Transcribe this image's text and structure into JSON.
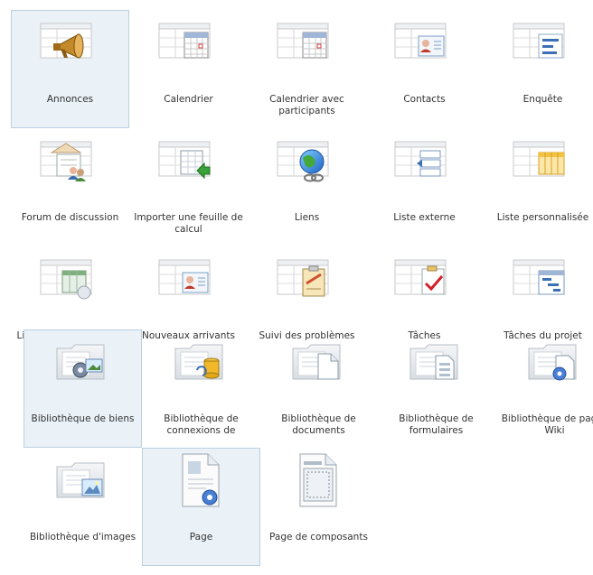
{
  "items": [
    {
      "label": "Annonces",
      "icon": "megaphone-icon"
    },
    {
      "label": "Calendrier",
      "icon": "calendar-icon"
    },
    {
      "label": "Calendrier avec participants",
      "icon": "calendar-icon"
    },
    {
      "label": "Contacts",
      "icon": "contact-card-icon"
    },
    {
      "label": "Enquête",
      "icon": "survey-icon"
    },
    {
      "label": "Forum de discussion",
      "icon": "discussion-icon"
    },
    {
      "label": "Importer une feuille de calcul",
      "icon": "import-spreadsheet-icon"
    },
    {
      "label": "Liens",
      "icon": "globe-link-icon"
    },
    {
      "label": "Liste externe",
      "icon": "external-list-icon"
    },
    {
      "label": "Liste personnalisée",
      "icon": "custom-list-icon"
    },
    {
      "label": "Liste personnalisée en mode Feuille de",
      "icon": "datasheet-icon"
    },
    {
      "label": "Nouveaux arrivants",
      "icon": "contact-card-icon"
    },
    {
      "label": "Suivi des problèmes",
      "icon": "clipboard-icon"
    },
    {
      "label": "Tâches",
      "icon": "task-check-icon"
    },
    {
      "label": "Tâches du projet",
      "icon": "gantt-icon"
    },
    {
      "label": "Bibliothèque de biens",
      "icon": "asset-library-icon"
    },
    {
      "label": "Bibliothèque de connexions de",
      "icon": "data-connection-icon"
    },
    {
      "label": "Bibliothèque de documents",
      "icon": "document-library-icon"
    },
    {
      "label": "Bibliothèque de formulaires",
      "icon": "form-library-icon"
    },
    {
      "label": "Bibliothèque de pages Wiki",
      "icon": "wiki-library-icon"
    },
    {
      "label": "Bibliothèque d'images",
      "icon": "picture-library-icon"
    },
    {
      "label": "Page",
      "icon": "page-icon"
    },
    {
      "label": "Page de composants",
      "icon": "web-part-page-icon"
    }
  ],
  "selected": [
    "Annonces",
    "Bibliothèque de biens",
    "Page"
  ],
  "colors": {
    "selected_bg": "#eaf1f7",
    "selected_border": "#bcd0e0",
    "text": "#333333"
  }
}
